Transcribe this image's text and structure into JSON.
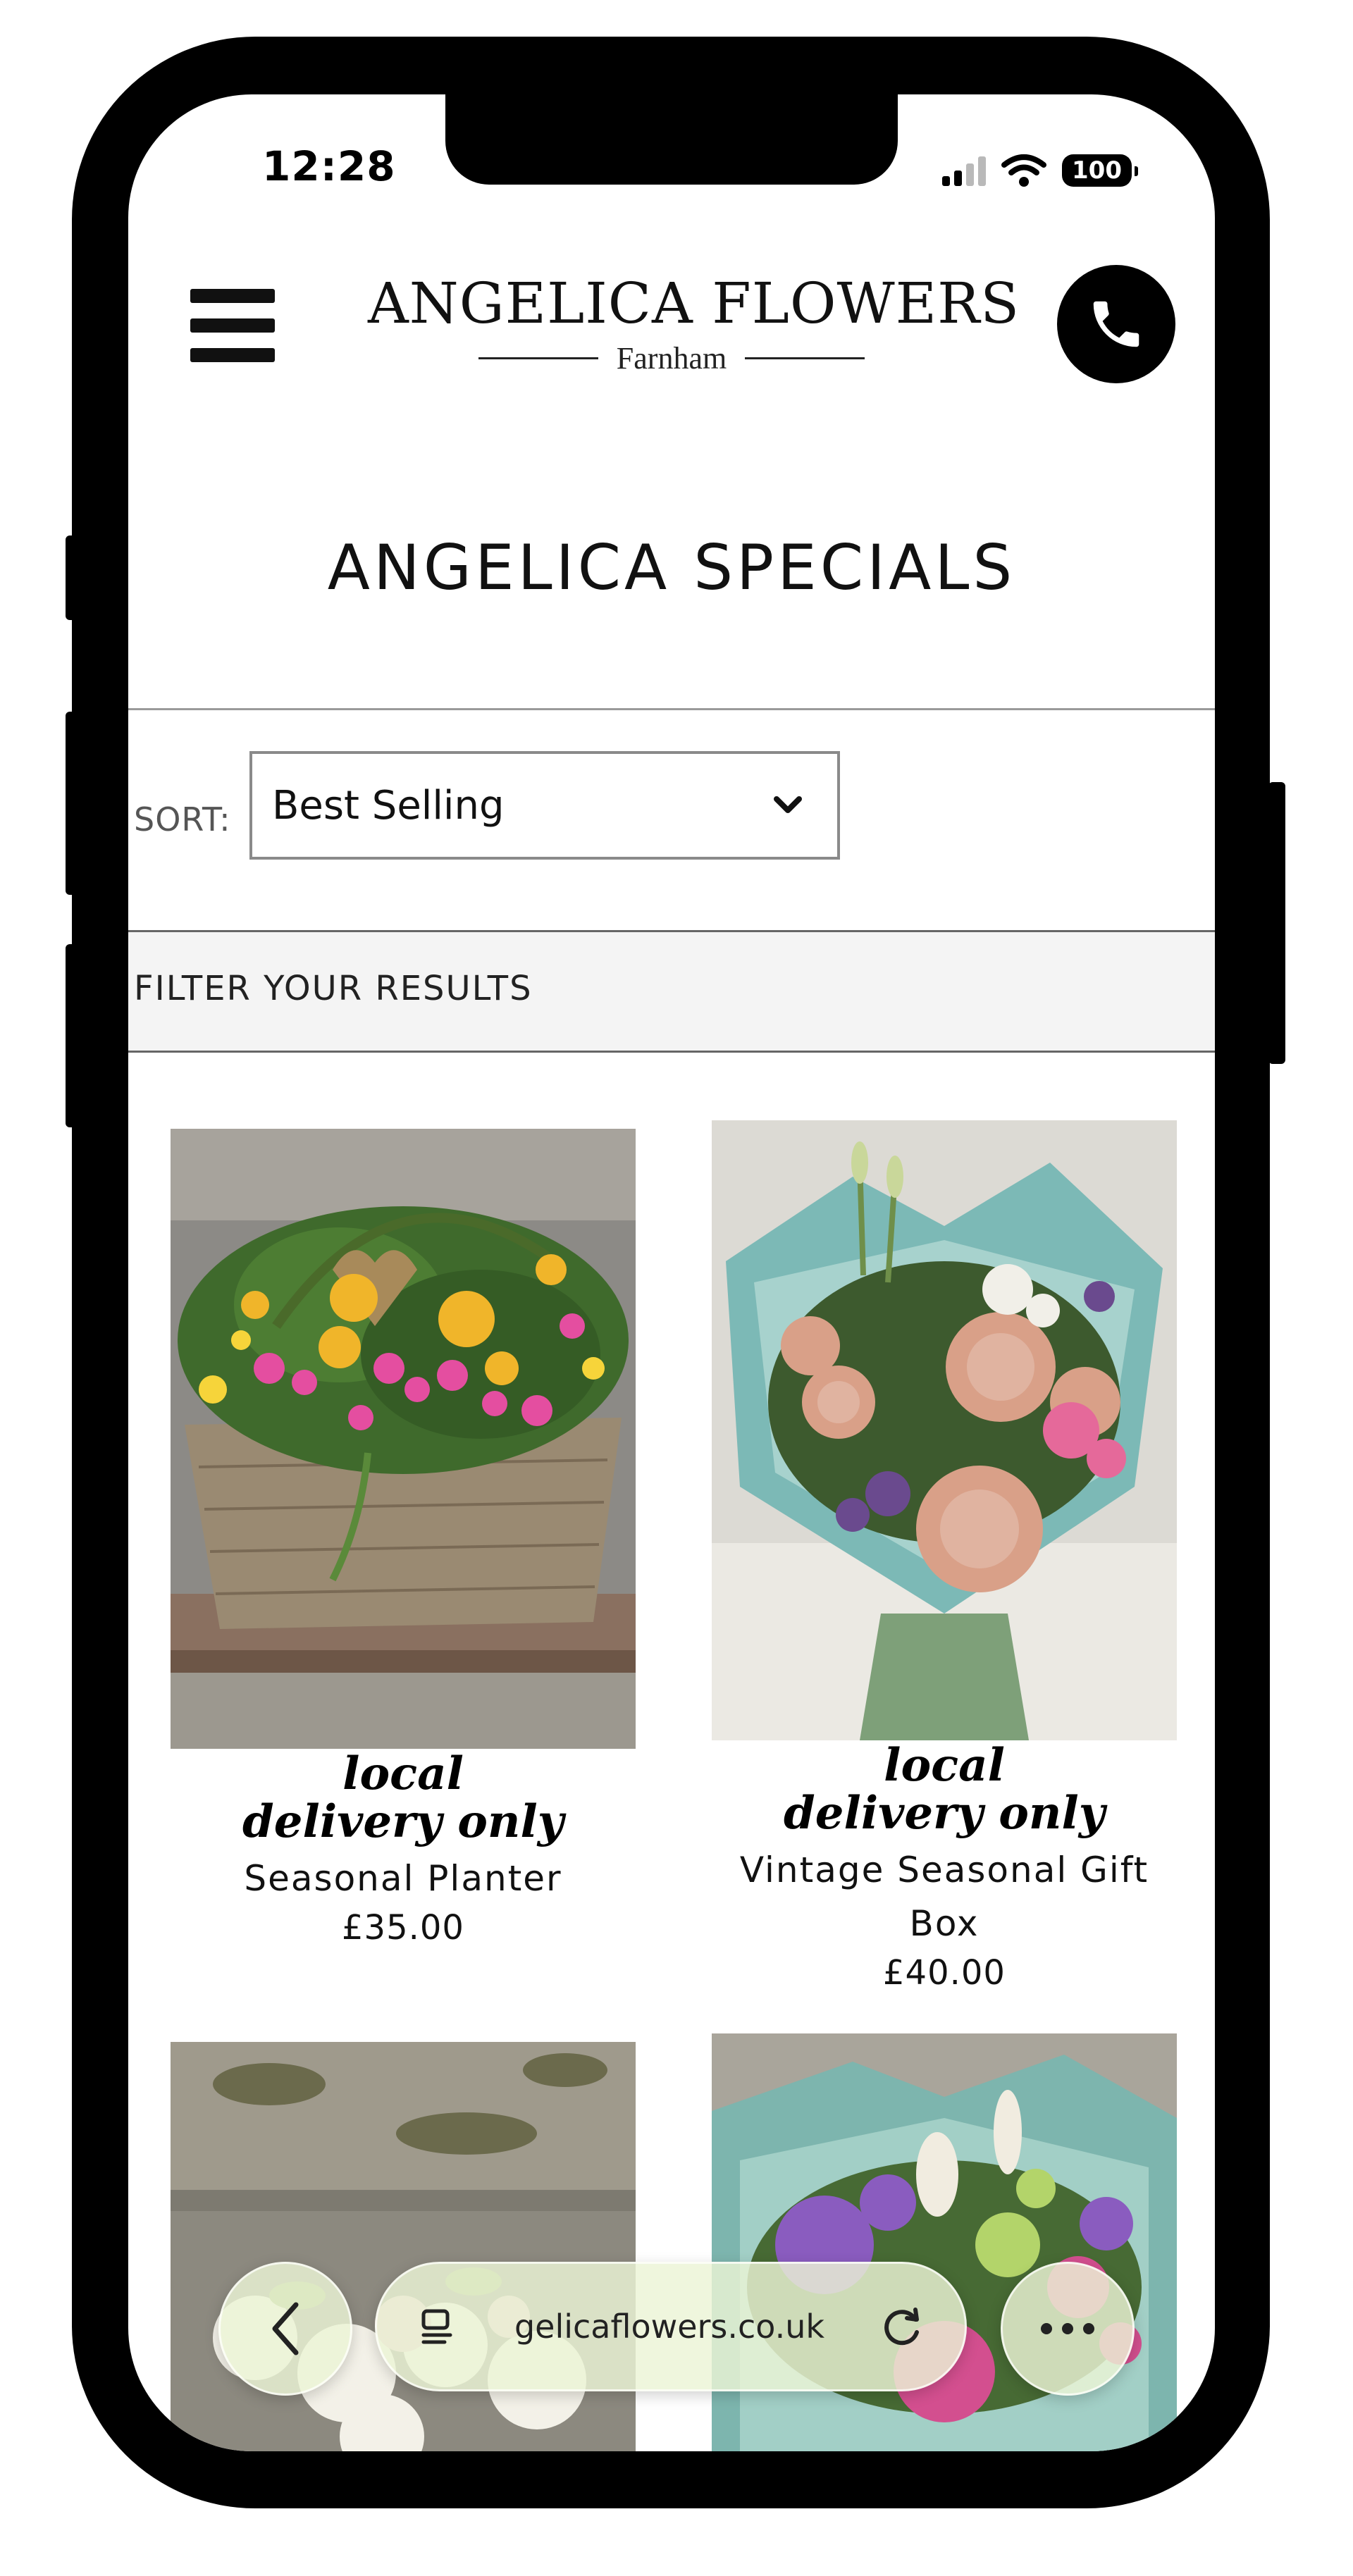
{
  "status_bar": {
    "time": "12:28",
    "battery": "100"
  },
  "header": {
    "menu_icon": "hamburger-icon",
    "logo_name": "ANGELICA FLOWERS",
    "logo_location": "Farnham",
    "phone_icon": "phone-icon"
  },
  "page": {
    "title": "ANGELICA SPECIALS"
  },
  "sort": {
    "label": "SORT:",
    "selected": "Best Selling",
    "icon": "chevron-down-icon"
  },
  "filter": {
    "label": "FILTER YOUR RESULTS"
  },
  "products": [
    {
      "badge": "local delivery only",
      "name": "Seasonal Planter",
      "price": "£35.00"
    },
    {
      "badge": "local delivery only",
      "name": "Vintage Seasonal Gift Box",
      "price": "£40.00"
    }
  ],
  "browser": {
    "url": "gelicaflowers.co.uk",
    "back_icon": "chevron-left-icon",
    "tabs_icon": "page-menu-icon",
    "reload_icon": "reload-icon",
    "more_icon": "more-dots-icon"
  },
  "colors": {
    "accent": "#000000",
    "filter_bg": "#f4f4f4",
    "browser_bar": "#ecf4d6"
  }
}
